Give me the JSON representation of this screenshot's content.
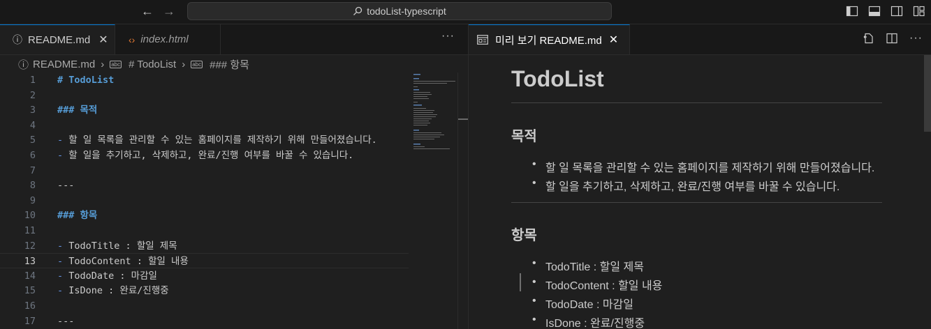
{
  "titlebar": {
    "search_text": "todoList-typescript"
  },
  "tabs_left": [
    {
      "label": "README.md",
      "icon": "info-icon",
      "active": true
    },
    {
      "label": "index.html",
      "icon": "html-code-icon",
      "active": false
    }
  ],
  "breadcrumb": {
    "file": "README.md",
    "section1": "# TodoList",
    "section2": "### 항목"
  },
  "editor": {
    "active_line": 13,
    "lines": [
      {
        "n": "1",
        "text": "# TodoList"
      },
      {
        "n": "2",
        "text": ""
      },
      {
        "n": "3",
        "text": "### 목적"
      },
      {
        "n": "4",
        "text": ""
      },
      {
        "n": "5",
        "text": "할 일 목록을 관리할 수 있는 홈페이지를 제작하기 위해 만들어졌습니다."
      },
      {
        "n": "6",
        "text": "할 일을 추기하고, 삭제하고, 완료/진행 여부를 바꿀 수 있습니다."
      },
      {
        "n": "7",
        "text": ""
      },
      {
        "n": "8",
        "text": "---"
      },
      {
        "n": "9",
        "text": ""
      },
      {
        "n": "10",
        "text": "### 항목"
      },
      {
        "n": "11",
        "text": ""
      },
      {
        "n": "12",
        "text": "TodoTitle : 할일 제목"
      },
      {
        "n": "13",
        "text": "TodoContent : 할일 내용"
      },
      {
        "n": "14",
        "text": "TodoDate : 마감일"
      },
      {
        "n": "15",
        "text": "IsDone : 완료/진행중"
      },
      {
        "n": "16",
        "text": ""
      },
      {
        "n": "17",
        "text": "---"
      }
    ],
    "dash_marker": "-"
  },
  "preview_tab": {
    "label": "미리 보기 README.md"
  },
  "preview": {
    "h1": "TodoList",
    "h3_purpose": "목적",
    "purpose_items": [
      "할 일 목록을 관리할 수 있는 홈페이지를 제작하기 위해 만들어졌습니다.",
      "할 일을 추기하고, 삭제하고, 완료/진행 여부를 바꿀 수 있습니다."
    ],
    "h3_items": "항목",
    "field_items": [
      "TodoTitle : 할일 제목",
      "TodoContent : 할일 내용",
      "TodoDate : 마감일",
      "IsDone : 완료/진행중"
    ]
  },
  "colors": {
    "accent": "#0078d4",
    "heading": "#569cd6",
    "list_marker": "#6796e6",
    "background": "#1f1f1f"
  }
}
